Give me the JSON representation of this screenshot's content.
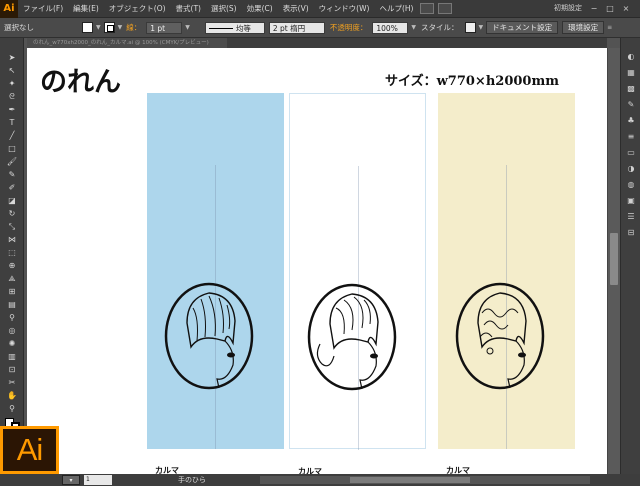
{
  "app": {
    "logo_text": "Ai",
    "workspace": "初期設定",
    "window_buttons": [
      "−",
      "□",
      "×"
    ]
  },
  "menu": {
    "items": [
      "ファイル(F)",
      "編集(E)",
      "オブジェクト(O)",
      "書式(T)",
      "選択(S)",
      "効果(C)",
      "表示(V)",
      "ウィンドウ(W)",
      "ヘルプ(H)"
    ]
  },
  "control": {
    "selection_status": "選択なし",
    "stroke_label": "線：",
    "stroke_weight": "1 pt",
    "stroke_profile": "均等",
    "brush": "2 pt 楕円",
    "opacity_label": "不透明度：",
    "opacity_value": "100%",
    "style_label": "スタイル：",
    "doc_settings": "ドキュメント設定",
    "preferences": "環境設定"
  },
  "tab": {
    "doc_name": "のれん_w770xh2000_のれん_カルマ.ai @ 100% (CMYK/プレビュー)"
  },
  "canvas": {
    "title": "のれん",
    "size_label": "サイズ：w770×h2000mm",
    "panels": [
      {
        "bg": "#add6ec",
        "brand": "カルマ"
      },
      {
        "bg": "#ffffff",
        "brand": "カルマ"
      },
      {
        "bg": "#f4edcb",
        "brand": "カルマ"
      }
    ]
  },
  "status": {
    "zoom": "▾",
    "page": "1",
    "tool_name": "手のひら"
  },
  "tools": [
    "selection-tool",
    "direct-selection-tool",
    "magic-wand-tool",
    "lasso-tool",
    "pen-tool",
    "type-tool",
    "line-tool",
    "rectangle-tool",
    "paintbrush-tool",
    "pencil-tool",
    "blob-brush-tool",
    "eraser-tool",
    "rotate-tool",
    "scale-tool",
    "width-tool",
    "free-transform-tool",
    "shape-builder-tool",
    "perspective-tool",
    "mesh-tool",
    "gradient-tool",
    "eyedropper-tool",
    "blend-tool",
    "symbol-sprayer-tool",
    "graph-tool",
    "artboard-tool",
    "slice-tool",
    "hand-tool",
    "zoom-tool"
  ]
}
